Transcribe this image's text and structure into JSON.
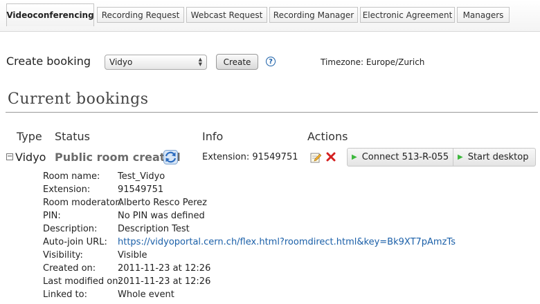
{
  "tabs": [
    {
      "label": "Videoconferencing",
      "active": true
    },
    {
      "label": "Recording Request",
      "active": false
    },
    {
      "label": "Webcast Request",
      "active": false
    },
    {
      "label": "Recording Manager",
      "active": false
    },
    {
      "label": "Electronic Agreement",
      "active": false
    },
    {
      "label": "Managers",
      "active": false
    }
  ],
  "create": {
    "label": "Create booking",
    "selected_plugin": "Vidyo",
    "button_label": "Create",
    "help_label": "?",
    "timezone": "Timezone: Europe/Zurich"
  },
  "section": {
    "title": "Current bookings"
  },
  "table": {
    "headers": {
      "type": "Type",
      "status": "Status",
      "info": "Info",
      "actions": "Actions"
    }
  },
  "booking": {
    "expand_symbol": "⊟",
    "type": "Vidyo",
    "status": "Public room created",
    "info": "Extension: 91549751",
    "connect_label": "Connect 513-R-055",
    "desktop_label": "Start desktop",
    "details": [
      {
        "key": "Room name:",
        "value": "Test_Vidyo"
      },
      {
        "key": "Extension:",
        "value": "91549751"
      },
      {
        "key": "Room moderator:",
        "value": "Alberto Resco Perez"
      },
      {
        "key": "PIN:",
        "value": "No PIN was defined"
      },
      {
        "key": "Description:",
        "value": "Description Test"
      },
      {
        "key": "Auto-join URL:",
        "value": "https://vidyoportal.cern.ch/flex.html?roomdirect.html&key=Bk9XT7pAmzTs",
        "link": true
      },
      {
        "key": "Visibility:",
        "value": "Visible"
      },
      {
        "key": "Created on:",
        "value": "2011-11-23 at 12:26"
      },
      {
        "key": "Last modified on:",
        "value": "2011-11-23 at 12:26"
      },
      {
        "key": "Linked to:",
        "value": "Whole event"
      }
    ]
  },
  "colors": {
    "link": "#1a5fa8",
    "status_text": "#6b6b6b",
    "play_icon": "#3cb83c",
    "delete_icon": "#d42020"
  }
}
